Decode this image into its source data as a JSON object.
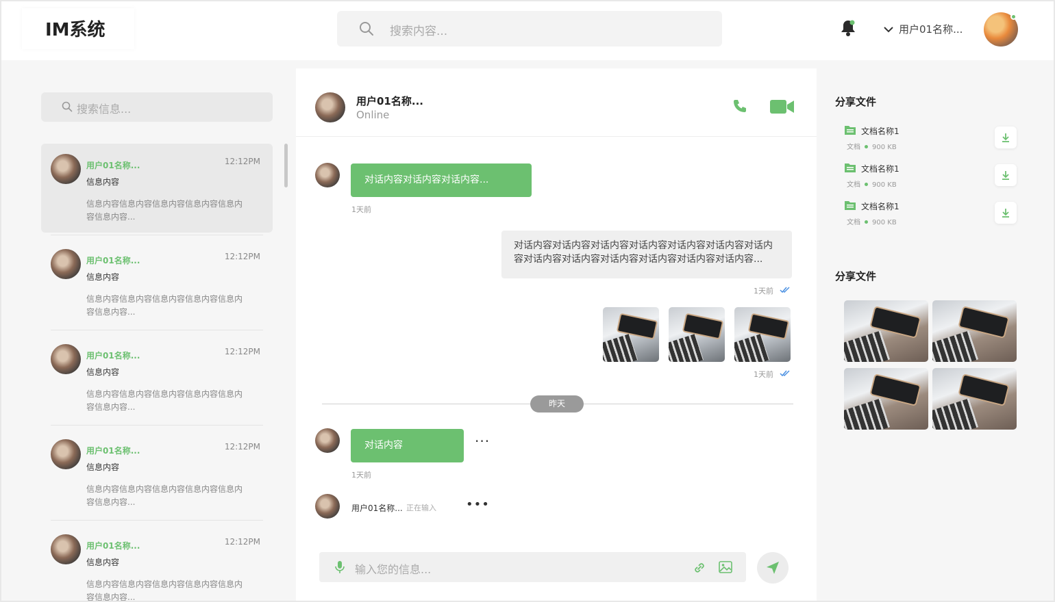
{
  "app": {
    "title": "IM系统",
    "accent": "#6cc070"
  },
  "header": {
    "search_placeholder": "搜索内容...",
    "user_name": "用户01名称..."
  },
  "sidebar": {
    "search_placeholder": "搜索信息...",
    "conversations": [
      {
        "name": "用户01名称...",
        "time": "12:12PM",
        "subtitle": "信息内容",
        "preview": "信息内容信息内容信息内容信息内容信息内容信息内容...",
        "active": true
      },
      {
        "name": "用户01名称...",
        "time": "12:12PM",
        "subtitle": "信息内容",
        "preview": "信息内容信息内容信息内容信息内容信息内容信息内容..."
      },
      {
        "name": "用户01名称...",
        "time": "12:12PM",
        "subtitle": "信息内容",
        "preview": "信息内容信息内容信息内容信息内容信息内容信息内容..."
      },
      {
        "name": "用户01名称...",
        "time": "12:12PM",
        "subtitle": "信息内容",
        "preview": "信息内容信息内容信息内容信息内容信息内容信息内容..."
      },
      {
        "name": "用户01名称...",
        "time": "12:12PM",
        "subtitle": "信息内容",
        "preview": "信息内容信息内容信息内容信息内容信息内容信息内容..."
      }
    ]
  },
  "chat": {
    "contact_name": "用户01名称...",
    "contact_status": "Online",
    "messages": [
      {
        "text": "对话内容对话内容对话内容...",
        "meta": "1天前"
      },
      {
        "text": "对话内容对话内容对话内容对话内容对话内容对话内容对话内容对话内容对话内容对话内容对话内容对话内容对话内容...",
        "meta": "1天前"
      },
      {
        "meta": "1天前"
      },
      {
        "text": "对话内容",
        "meta": "1天前"
      }
    ],
    "divider_label": "昨天",
    "typing": {
      "name": "用户01名称...",
      "status": "正在输入"
    },
    "input_placeholder": "输入您的信息..."
  },
  "right_panel": {
    "files_title": "分享文件",
    "files": [
      {
        "name": "文档名称1",
        "type": "文档",
        "size": "900 KB"
      },
      {
        "name": "文档名称1",
        "type": "文档",
        "size": "900 KB"
      },
      {
        "name": "文档名称1",
        "type": "文档",
        "size": "900 KB"
      }
    ],
    "images_title": "分享文件"
  }
}
